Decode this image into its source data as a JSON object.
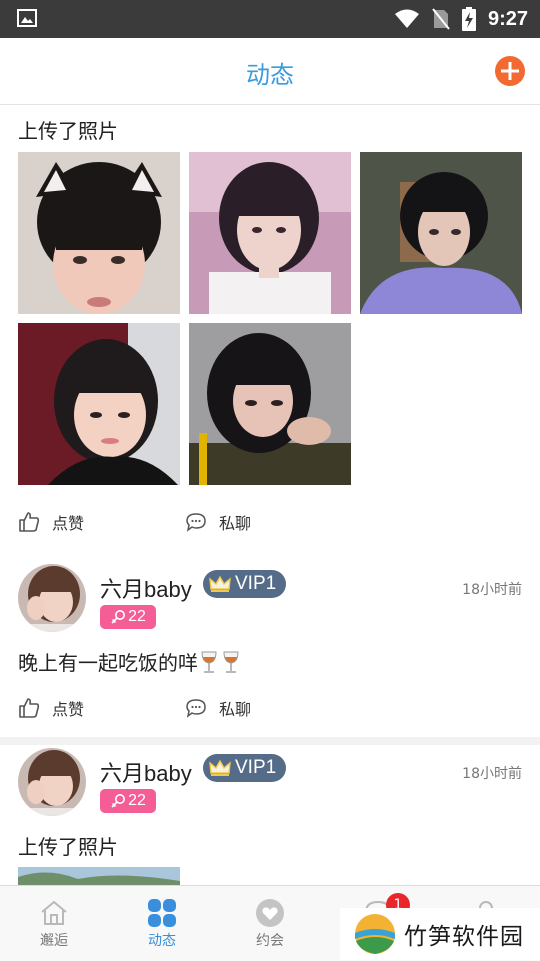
{
  "status_bar": {
    "time": "9:27"
  },
  "header": {
    "title": "动态"
  },
  "posts": [
    {
      "text": "上传了照片",
      "actions": {
        "like": "点赞",
        "chat": "私聊"
      }
    },
    {
      "username": "六月baby",
      "vip": "VIP1",
      "age": "22",
      "time": "18小时前",
      "text": "晚上有一起吃饭的咩",
      "actions": {
        "like": "点赞",
        "chat": "私聊"
      }
    },
    {
      "username": "六月baby",
      "vip": "VIP1",
      "age": "22",
      "time": "18小时前",
      "text": "上传了照片"
    }
  ],
  "bottom_nav": [
    {
      "label": "邂逅",
      "icon": "home-icon"
    },
    {
      "label": "动态",
      "icon": "dynamics-icon",
      "active": true
    },
    {
      "label": "约会",
      "icon": "heart-icon"
    },
    {
      "label": "",
      "icon": "message-icon",
      "badge": "1"
    },
    {
      "label": "",
      "icon": "profile-icon"
    }
  ],
  "watermark": {
    "text": "竹笋软件园"
  },
  "colors": {
    "accent": "#3a9be0",
    "add": "#f26a31",
    "vip": "#556c89",
    "age_badge": "#f45d95",
    "badge": "#e8262c"
  }
}
